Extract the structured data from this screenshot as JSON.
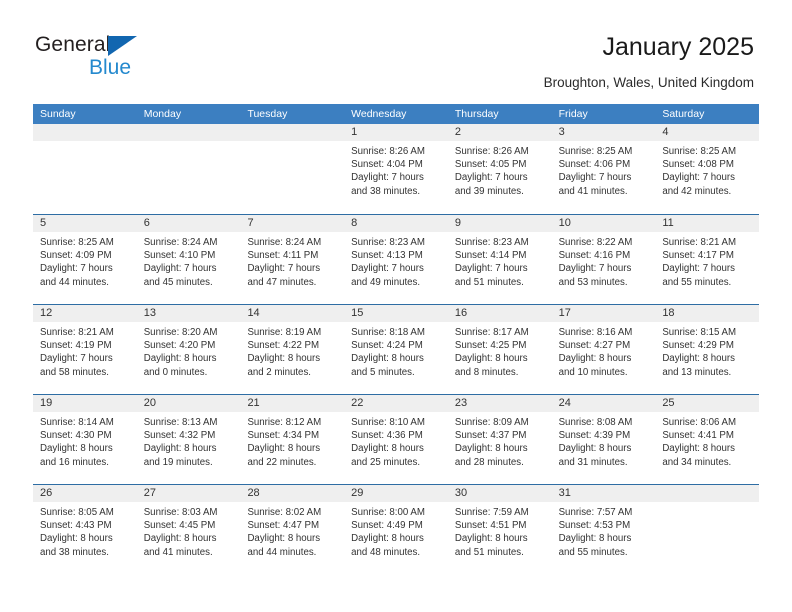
{
  "brand": {
    "name_part1": "General",
    "name_part2": "Blue",
    "accent_color": "#2489ce",
    "triangle_color": "#1166b0"
  },
  "header": {
    "title": "January 2025",
    "subtitle": "Broughton, Wales, United Kingdom"
  },
  "calendar": {
    "header_bg": "#3c7fc1",
    "row_divider_color": "#2e6da4",
    "day_band_bg": "#efefef",
    "weekdays": [
      "Sunday",
      "Monday",
      "Tuesday",
      "Wednesday",
      "Thursday",
      "Friday",
      "Saturday"
    ],
    "weeks": [
      [
        {
          "day": "",
          "lines": []
        },
        {
          "day": "",
          "lines": []
        },
        {
          "day": "",
          "lines": []
        },
        {
          "day": "1",
          "lines": [
            "Sunrise: 8:26 AM",
            "Sunset: 4:04 PM",
            "Daylight: 7 hours",
            "and 38 minutes."
          ]
        },
        {
          "day": "2",
          "lines": [
            "Sunrise: 8:26 AM",
            "Sunset: 4:05 PM",
            "Daylight: 7 hours",
            "and 39 minutes."
          ]
        },
        {
          "day": "3",
          "lines": [
            "Sunrise: 8:25 AM",
            "Sunset: 4:06 PM",
            "Daylight: 7 hours",
            "and 41 minutes."
          ]
        },
        {
          "day": "4",
          "lines": [
            "Sunrise: 8:25 AM",
            "Sunset: 4:08 PM",
            "Daylight: 7 hours",
            "and 42 minutes."
          ]
        }
      ],
      [
        {
          "day": "5",
          "lines": [
            "Sunrise: 8:25 AM",
            "Sunset: 4:09 PM",
            "Daylight: 7 hours",
            "and 44 minutes."
          ]
        },
        {
          "day": "6",
          "lines": [
            "Sunrise: 8:24 AM",
            "Sunset: 4:10 PM",
            "Daylight: 7 hours",
            "and 45 minutes."
          ]
        },
        {
          "day": "7",
          "lines": [
            "Sunrise: 8:24 AM",
            "Sunset: 4:11 PM",
            "Daylight: 7 hours",
            "and 47 minutes."
          ]
        },
        {
          "day": "8",
          "lines": [
            "Sunrise: 8:23 AM",
            "Sunset: 4:13 PM",
            "Daylight: 7 hours",
            "and 49 minutes."
          ]
        },
        {
          "day": "9",
          "lines": [
            "Sunrise: 8:23 AM",
            "Sunset: 4:14 PM",
            "Daylight: 7 hours",
            "and 51 minutes."
          ]
        },
        {
          "day": "10",
          "lines": [
            "Sunrise: 8:22 AM",
            "Sunset: 4:16 PM",
            "Daylight: 7 hours",
            "and 53 minutes."
          ]
        },
        {
          "day": "11",
          "lines": [
            "Sunrise: 8:21 AM",
            "Sunset: 4:17 PM",
            "Daylight: 7 hours",
            "and 55 minutes."
          ]
        }
      ],
      [
        {
          "day": "12",
          "lines": [
            "Sunrise: 8:21 AM",
            "Sunset: 4:19 PM",
            "Daylight: 7 hours",
            "and 58 minutes."
          ]
        },
        {
          "day": "13",
          "lines": [
            "Sunrise: 8:20 AM",
            "Sunset: 4:20 PM",
            "Daylight: 8 hours",
            "and 0 minutes."
          ]
        },
        {
          "day": "14",
          "lines": [
            "Sunrise: 8:19 AM",
            "Sunset: 4:22 PM",
            "Daylight: 8 hours",
            "and 2 minutes."
          ]
        },
        {
          "day": "15",
          "lines": [
            "Sunrise: 8:18 AM",
            "Sunset: 4:24 PM",
            "Daylight: 8 hours",
            "and 5 minutes."
          ]
        },
        {
          "day": "16",
          "lines": [
            "Sunrise: 8:17 AM",
            "Sunset: 4:25 PM",
            "Daylight: 8 hours",
            "and 8 minutes."
          ]
        },
        {
          "day": "17",
          "lines": [
            "Sunrise: 8:16 AM",
            "Sunset: 4:27 PM",
            "Daylight: 8 hours",
            "and 10 minutes."
          ]
        },
        {
          "day": "18",
          "lines": [
            "Sunrise: 8:15 AM",
            "Sunset: 4:29 PM",
            "Daylight: 8 hours",
            "and 13 minutes."
          ]
        }
      ],
      [
        {
          "day": "19",
          "lines": [
            "Sunrise: 8:14 AM",
            "Sunset: 4:30 PM",
            "Daylight: 8 hours",
            "and 16 minutes."
          ]
        },
        {
          "day": "20",
          "lines": [
            "Sunrise: 8:13 AM",
            "Sunset: 4:32 PM",
            "Daylight: 8 hours",
            "and 19 minutes."
          ]
        },
        {
          "day": "21",
          "lines": [
            "Sunrise: 8:12 AM",
            "Sunset: 4:34 PM",
            "Daylight: 8 hours",
            "and 22 minutes."
          ]
        },
        {
          "day": "22",
          "lines": [
            "Sunrise: 8:10 AM",
            "Sunset: 4:36 PM",
            "Daylight: 8 hours",
            "and 25 minutes."
          ]
        },
        {
          "day": "23",
          "lines": [
            "Sunrise: 8:09 AM",
            "Sunset: 4:37 PM",
            "Daylight: 8 hours",
            "and 28 minutes."
          ]
        },
        {
          "day": "24",
          "lines": [
            "Sunrise: 8:08 AM",
            "Sunset: 4:39 PM",
            "Daylight: 8 hours",
            "and 31 minutes."
          ]
        },
        {
          "day": "25",
          "lines": [
            "Sunrise: 8:06 AM",
            "Sunset: 4:41 PM",
            "Daylight: 8 hours",
            "and 34 minutes."
          ]
        }
      ],
      [
        {
          "day": "26",
          "lines": [
            "Sunrise: 8:05 AM",
            "Sunset: 4:43 PM",
            "Daylight: 8 hours",
            "and 38 minutes."
          ]
        },
        {
          "day": "27",
          "lines": [
            "Sunrise: 8:03 AM",
            "Sunset: 4:45 PM",
            "Daylight: 8 hours",
            "and 41 minutes."
          ]
        },
        {
          "day": "28",
          "lines": [
            "Sunrise: 8:02 AM",
            "Sunset: 4:47 PM",
            "Daylight: 8 hours",
            "and 44 minutes."
          ]
        },
        {
          "day": "29",
          "lines": [
            "Sunrise: 8:00 AM",
            "Sunset: 4:49 PM",
            "Daylight: 8 hours",
            "and 48 minutes."
          ]
        },
        {
          "day": "30",
          "lines": [
            "Sunrise: 7:59 AM",
            "Sunset: 4:51 PM",
            "Daylight: 8 hours",
            "and 51 minutes."
          ]
        },
        {
          "day": "31",
          "lines": [
            "Sunrise: 7:57 AM",
            "Sunset: 4:53 PM",
            "Daylight: 8 hours",
            "and 55 minutes."
          ]
        },
        {
          "day": "",
          "lines": []
        }
      ]
    ]
  }
}
